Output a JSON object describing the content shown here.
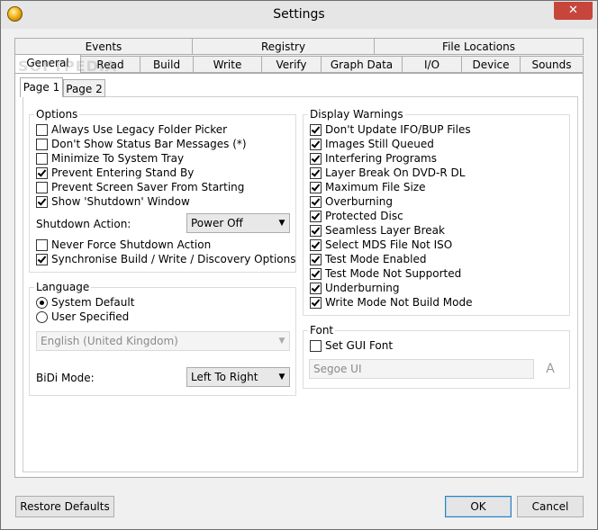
{
  "window": {
    "title": "Settings",
    "close_glyph": "✕",
    "app_icon": "imgburn-disc-icon"
  },
  "tabs_row1": [
    "Events",
    "Registry",
    "File Locations"
  ],
  "tabs_row2": [
    "General",
    "Read",
    "Build",
    "Write",
    "Verify",
    "Graph Data",
    "I/O",
    "Device",
    "Sounds"
  ],
  "selected_tab": "General",
  "subtabs": [
    "Page 1",
    "Page 2"
  ],
  "selected_subtab": "Page 1",
  "options": {
    "title": "Options",
    "items": [
      {
        "label": "Always Use Legacy Folder Picker",
        "checked": false
      },
      {
        "label": "Don't Show Status Bar Messages (*)",
        "checked": false
      },
      {
        "label": "Minimize To System Tray",
        "checked": false
      },
      {
        "label": "Prevent Entering Stand By",
        "checked": true
      },
      {
        "label": "Prevent Screen Saver From Starting",
        "checked": false
      },
      {
        "label": "Show 'Shutdown' Window",
        "checked": true
      }
    ],
    "shutdown_label": "Shutdown Action:",
    "shutdown_value": "Power Off",
    "items2": [
      {
        "label": "Never Force Shutdown Action",
        "checked": false
      },
      {
        "label": "Synchronise Build / Write / Discovery Options",
        "checked": true
      }
    ]
  },
  "language": {
    "title": "Language",
    "radios": [
      {
        "label": "System Default",
        "checked": true
      },
      {
        "label": "User Specified",
        "checked": false
      }
    ],
    "language_value": "English (United Kingdom)",
    "bidi_label": "BiDi Mode:",
    "bidi_value": "Left To Right"
  },
  "display_warnings": {
    "title": "Display Warnings",
    "items": [
      {
        "label": "Don't Update IFO/BUP Files",
        "checked": true
      },
      {
        "label": "Images Still Queued",
        "checked": true
      },
      {
        "label": "Interfering Programs",
        "checked": true
      },
      {
        "label": "Layer Break On DVD-R DL",
        "checked": true
      },
      {
        "label": "Maximum File Size",
        "checked": true
      },
      {
        "label": "Overburning",
        "checked": true
      },
      {
        "label": "Protected Disc",
        "checked": true
      },
      {
        "label": "Seamless Layer Break",
        "checked": true
      },
      {
        "label": "Select MDS File Not ISO",
        "checked": true
      },
      {
        "label": "Test Mode Enabled",
        "checked": true
      },
      {
        "label": "Test Mode Not Supported",
        "checked": true
      },
      {
        "label": "Underburning",
        "checked": true
      },
      {
        "label": "Write Mode Not Build Mode",
        "checked": true
      }
    ]
  },
  "font": {
    "title": "Font",
    "set_gui_font_label": "Set GUI Font",
    "set_gui_font_checked": false,
    "font_value": "Segoe UI",
    "font_button_glyph": "A"
  },
  "buttons": {
    "restore": "Restore Defaults",
    "ok": "OK",
    "cancel": "Cancel"
  },
  "watermark": "SOFTPEDIA"
}
